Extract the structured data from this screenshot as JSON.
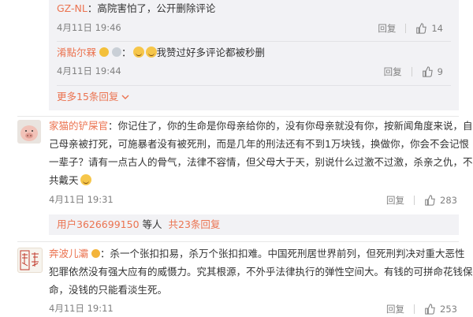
{
  "replies": [
    {
      "user": "GZ-NL",
      "sep": "：",
      "text": "高院害怕了，公开删除评论",
      "time": "4月11日 19:46",
      "reply_label": "回复",
      "likes": "14"
    },
    {
      "user": "淆點尔槑",
      "sep": "：",
      "text": "我赞过好多评论都被秒删",
      "time": "4月11日 19:44",
      "reply_label": "回复",
      "likes": "9"
    }
  ],
  "more_replies": "更多15条回复",
  "comments": [
    {
      "user": "家猫的铲屎官",
      "sep": "：",
      "lines": [
        "你记住了，你的生命是你母亲给你的，没有你母亲就没有你，按新闻角度来说，自",
        "己母亲被打死，可施暴者没有被死刑，而是几年的刑法还有不到1万块钱，换做你，你会不会记恨",
        "一辈子？请有一点古人的骨气，法律不容情，但父母大于天，别说什么过激不过激，杀亲之仇，不",
        "共戴天"
      ],
      "time": "4月11日 19:31",
      "reply_label": "回复",
      "likes": "283",
      "liked_by": "用户3626699150",
      "liked_by_suffix": " 等人",
      "total_replies": "共23条回复"
    },
    {
      "user": "奔波儿灞",
      "sep": "：",
      "lines": [
        "杀一个张扣扣易，杀万个张扣扣难。中国死刑居世界前列，但死刑判决对重大恶性",
        "犯罪依然没有强大应有的威慑力。究其根源，不外乎法律执行的弹性空间大。有钱的可拼命花钱保",
        "命，没钱的只能看淡生死。"
      ],
      "time": "4月11日 19:11",
      "reply_label": "回复",
      "likes": "253"
    }
  ],
  "colors": {
    "name": "#eb7350",
    "reply_bg": "#f2f2f5",
    "meta": "#808080"
  }
}
